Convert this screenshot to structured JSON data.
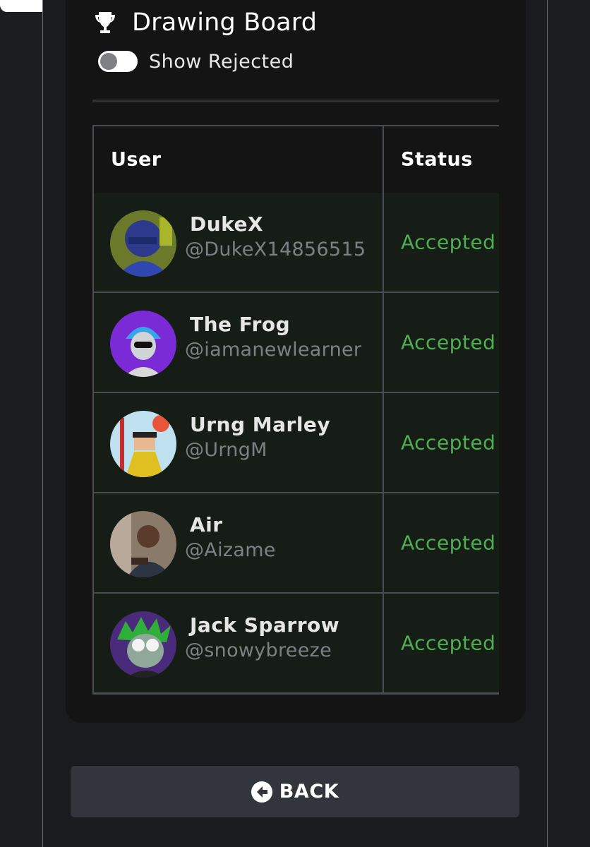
{
  "header": {
    "title": "Drawing Board",
    "trophy_icon": "trophy-icon"
  },
  "filter": {
    "toggle_label": "Show Rejected",
    "toggle_on": false
  },
  "table": {
    "columns": [
      "User",
      "Status"
    ],
    "rows": [
      {
        "name": "DukeX",
        "handle": "@DukeX14856515",
        "status": "Accepted"
      },
      {
        "name": "The Frog",
        "handle": "@iamanewlearner",
        "status": "Accepted"
      },
      {
        "name": "Urng Marley",
        "handle": "@UrngM",
        "status": "Accepted"
      },
      {
        "name": "Air",
        "handle": "@Aizame",
        "status": "Accepted"
      },
      {
        "name": "Jack Sparrow",
        "handle": "@snowybreeze",
        "status": "Accepted"
      }
    ]
  },
  "footer": {
    "back_label": "BACK",
    "back_icon": "arrow-circle-left-icon"
  },
  "colors": {
    "accepted": "#4caf50",
    "row_bg": "#161d16",
    "button_bg": "#32353c"
  }
}
